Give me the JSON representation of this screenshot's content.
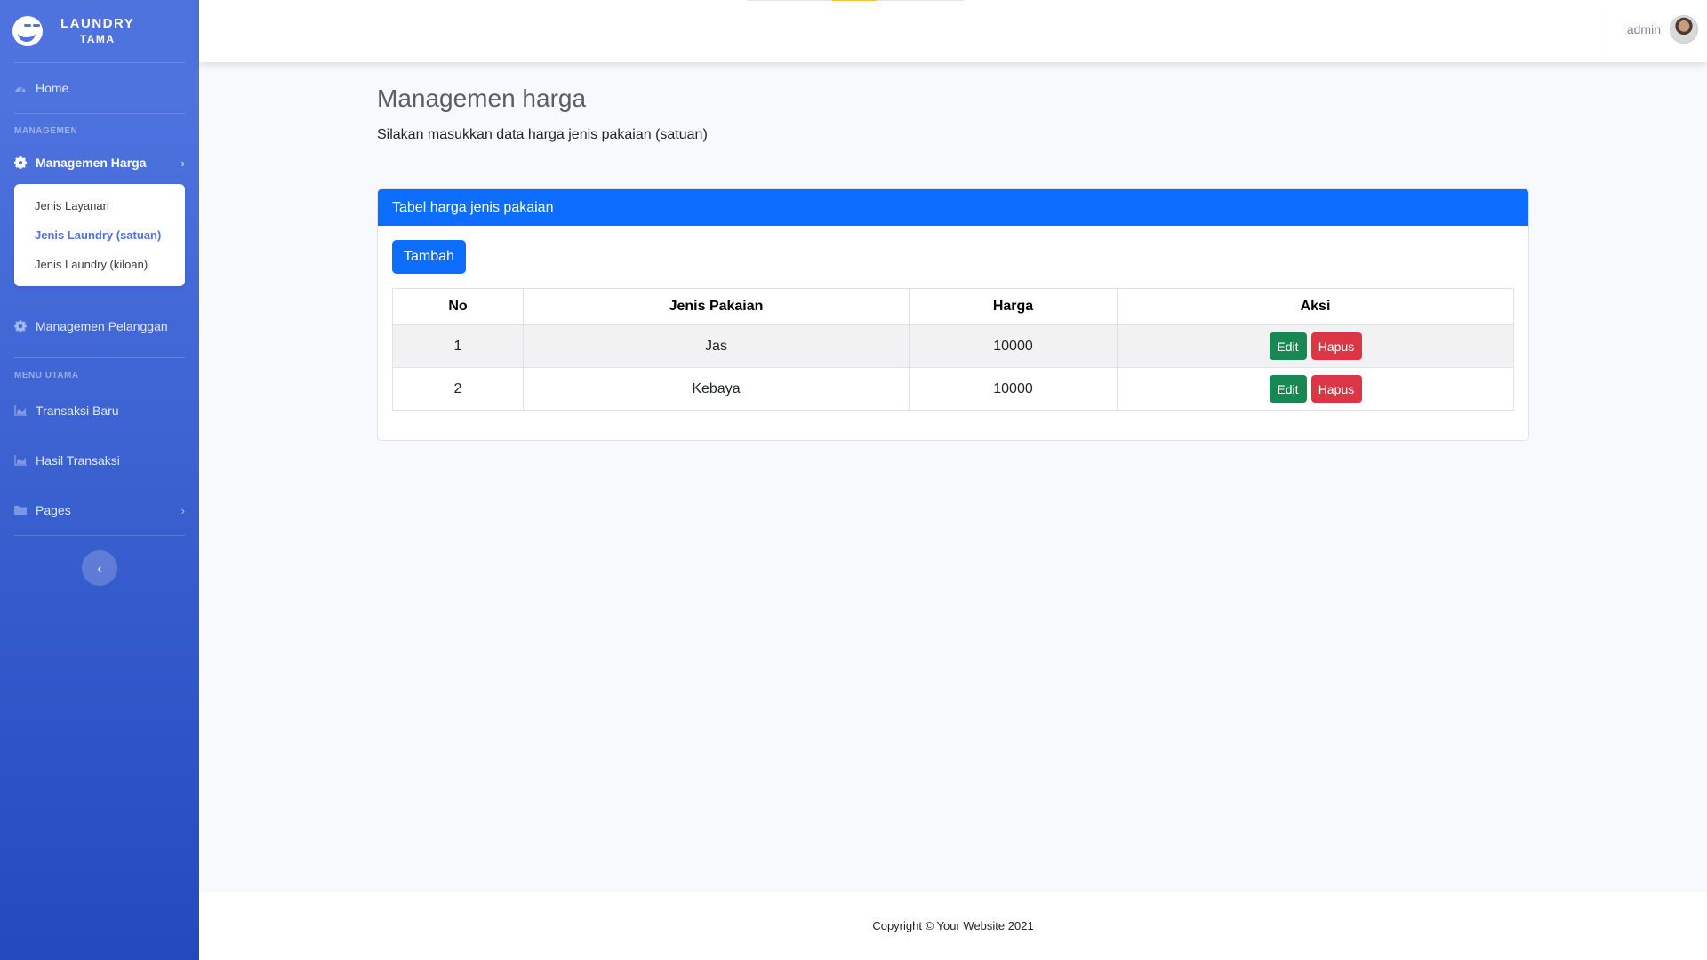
{
  "brand": {
    "line1": "LAUNDRY",
    "line2": "TAMA"
  },
  "sidebar": {
    "home": "Home",
    "heading_managemen": "MANAGEMEN",
    "managemen_harga": "Managemen Harga",
    "submenu": [
      "Jenis Layanan",
      "Jenis Laundry (satuan)",
      "Jenis Laundry (kiloan)"
    ],
    "managemen_pelanggan": "Managemen Pelanggan",
    "heading_menu_utama": "MENU UTAMA",
    "transaksi_baru": "Transaksi Baru",
    "hasil_transaksi": "Hasil Transaksi",
    "pages": "Pages",
    "toggle": "‹"
  },
  "topbar": {
    "user": "admin"
  },
  "main": {
    "title": "Managemen harga",
    "subtitle": "Silakan masukkan data harga jenis pakaian (satuan)",
    "card_title": "Tabel harga jenis pakaian",
    "add_button": "Tambah",
    "columns": [
      "No",
      "Jenis Pakaian",
      "Harga",
      "Aksi"
    ],
    "rows": [
      {
        "no": "1",
        "jenis": "Jas",
        "harga": "10000"
      },
      {
        "no": "2",
        "jenis": "Kebaya",
        "harga": "10000"
      }
    ],
    "edit_label": "Edit",
    "delete_label": "Hapus"
  },
  "footer": {
    "text": "Copyright © Your Website 2021"
  },
  "colors": {
    "sidebar_top": "#4e73df",
    "sidebar_bottom": "#224abe",
    "primary": "#0d6efd",
    "success": "#198754",
    "danger": "#dc3545"
  },
  "icons": {
    "brand": "laugh-wink-icon",
    "home": "dashboard-icon",
    "managemen_harga": "gear-icon",
    "managemen_pelanggan": "gear-icon",
    "transaksi": "chart-area-icon",
    "pages": "folder-icon"
  }
}
